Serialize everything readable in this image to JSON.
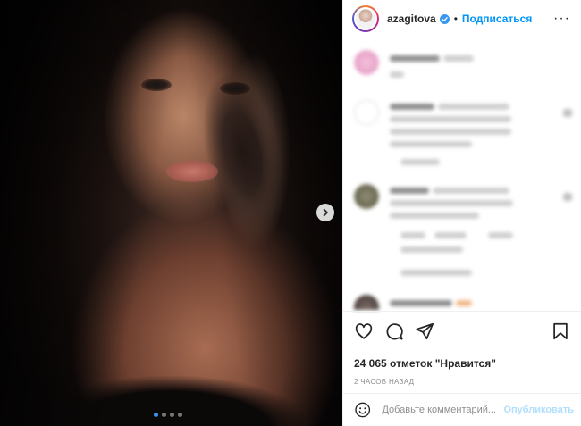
{
  "post": {
    "carousel": {
      "slide_count": 4,
      "active_slide": 1
    }
  },
  "header": {
    "username": "azagitova",
    "separator": "•",
    "follow_label": "Подписаться",
    "more_label": "···"
  },
  "actions": {
    "likes_text": "24 065 отметок \"Нравится\"",
    "timestamp": "2 часов назад"
  },
  "composer": {
    "placeholder": "Добавьте комментарий...",
    "post_label": "Опубликовать"
  },
  "icons": {
    "verified": "verified-badge-icon",
    "like": "heart-icon",
    "comment": "comment-icon",
    "share": "paper-plane-icon",
    "save": "bookmark-icon",
    "emoji": "emoji-smile-icon",
    "next": "chevron-right-icon",
    "more": "more-dots-icon"
  },
  "colors": {
    "link_blue": "#0095f6",
    "post_disabled": "#b2dffc",
    "active_dot": "#3897f0",
    "text_primary": "#262626",
    "text_secondary": "#8e8e8e"
  }
}
